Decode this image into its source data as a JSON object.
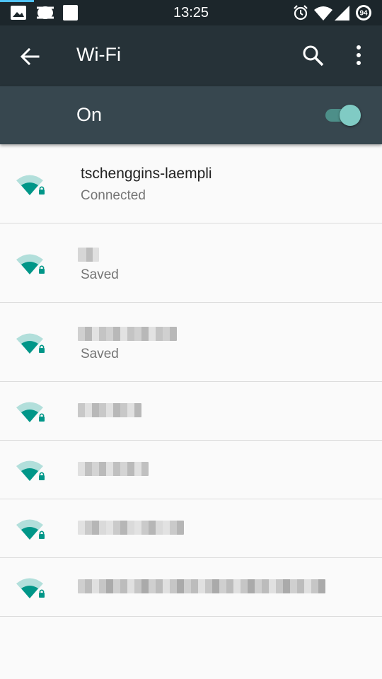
{
  "status_bar": {
    "time": "13:25",
    "battery_level": "94",
    "left_icons": [
      "image-icon",
      "cast-icon",
      "square-icon"
    ],
    "right_icons": [
      "alarm-icon",
      "wifi-icon",
      "cell-signal-icon",
      "battery-icon"
    ]
  },
  "app_bar": {
    "title": "Wi-Fi",
    "back_icon": "arrow-back-icon",
    "search_icon": "search-icon",
    "more_icon": "more-vert-icon"
  },
  "wifi_switch": {
    "label": "On",
    "enabled": true,
    "accent": "#80cbc4"
  },
  "colors": {
    "status_bar": "#1c262b",
    "app_bar": "#263238",
    "switch_bar": "#37474f",
    "wifi_icon": "#009688",
    "background": "#fafafa"
  },
  "networks": [
    {
      "ssid": "tschenggins-laempli",
      "status": "Connected",
      "ssid_obscured": false,
      "secured": true
    },
    {
      "ssid": "",
      "status": "Saved",
      "ssid_obscured": true,
      "secured": true
    },
    {
      "ssid": "",
      "status": "Saved",
      "ssid_obscured": true,
      "secured": true
    },
    {
      "ssid": "",
      "status": "",
      "ssid_obscured": true,
      "secured": true
    },
    {
      "ssid": "",
      "status": "",
      "ssid_obscured": true,
      "secured": true
    },
    {
      "ssid": "",
      "status": "",
      "ssid_obscured": true,
      "secured": true
    },
    {
      "ssid": "",
      "status": "",
      "ssid_obscured": true,
      "secured": true
    }
  ]
}
